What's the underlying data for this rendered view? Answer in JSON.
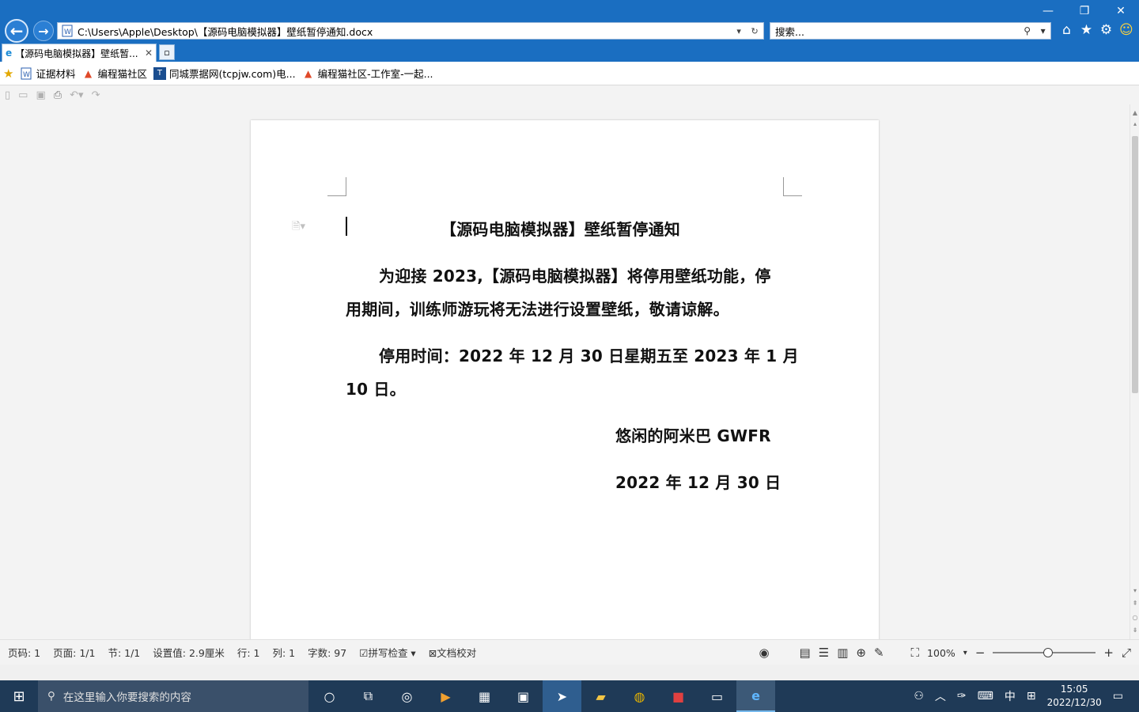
{
  "window": {
    "address": "C:\\Users\\Apple\\Desktop\\【源码电脑模拟器】壁纸暂停通知.docx",
    "search_placeholder": "搜索...",
    "tab_title": "【源码电脑模拟器】壁纸暂..."
  },
  "favorites": [
    {
      "label": "证据材料",
      "icon": "word-doc-icon"
    },
    {
      "label": "编程猫社区",
      "icon": "codemao-icon"
    },
    {
      "label": "同城票据网(tcpjw.com)电...",
      "icon": "tcpjw-icon"
    },
    {
      "label": "编程猫社区-工作室-一起...",
      "icon": "codemao-icon"
    }
  ],
  "document": {
    "title": "【源码电脑模拟器】壁纸暂停通知",
    "para1_line1": "为迎接 2023,【源码电脑模拟器】将停用壁纸功能，停",
    "para1_line2": "用期间，训练师游玩将无法进行设置壁纸，敬请谅解。",
    "para2_line1": "停用时间：2022 年 12 月 30 日星期五至 2023 年 1 月",
    "para2_line2": "10 日。",
    "signature": "悠闲的阿米巴 GWFR",
    "date": "2022 年 12 月 30 日"
  },
  "status": {
    "page_num": "页码: 1",
    "pages": "页面: 1/1",
    "section": "节: 1/1",
    "setting": "设置值: 2.9厘米",
    "row": "行: 1",
    "col": "列: 1",
    "word_count": "字数: 97",
    "spell_check": "拼写检查",
    "doc_proof": "文档校对",
    "zoom": "100%",
    "zoom_level_percent": 100
  },
  "taskbar": {
    "search_placeholder": "在这里输入你要搜索的内容",
    "ime": "中",
    "time": "15:05",
    "date": "2022/12/30"
  }
}
